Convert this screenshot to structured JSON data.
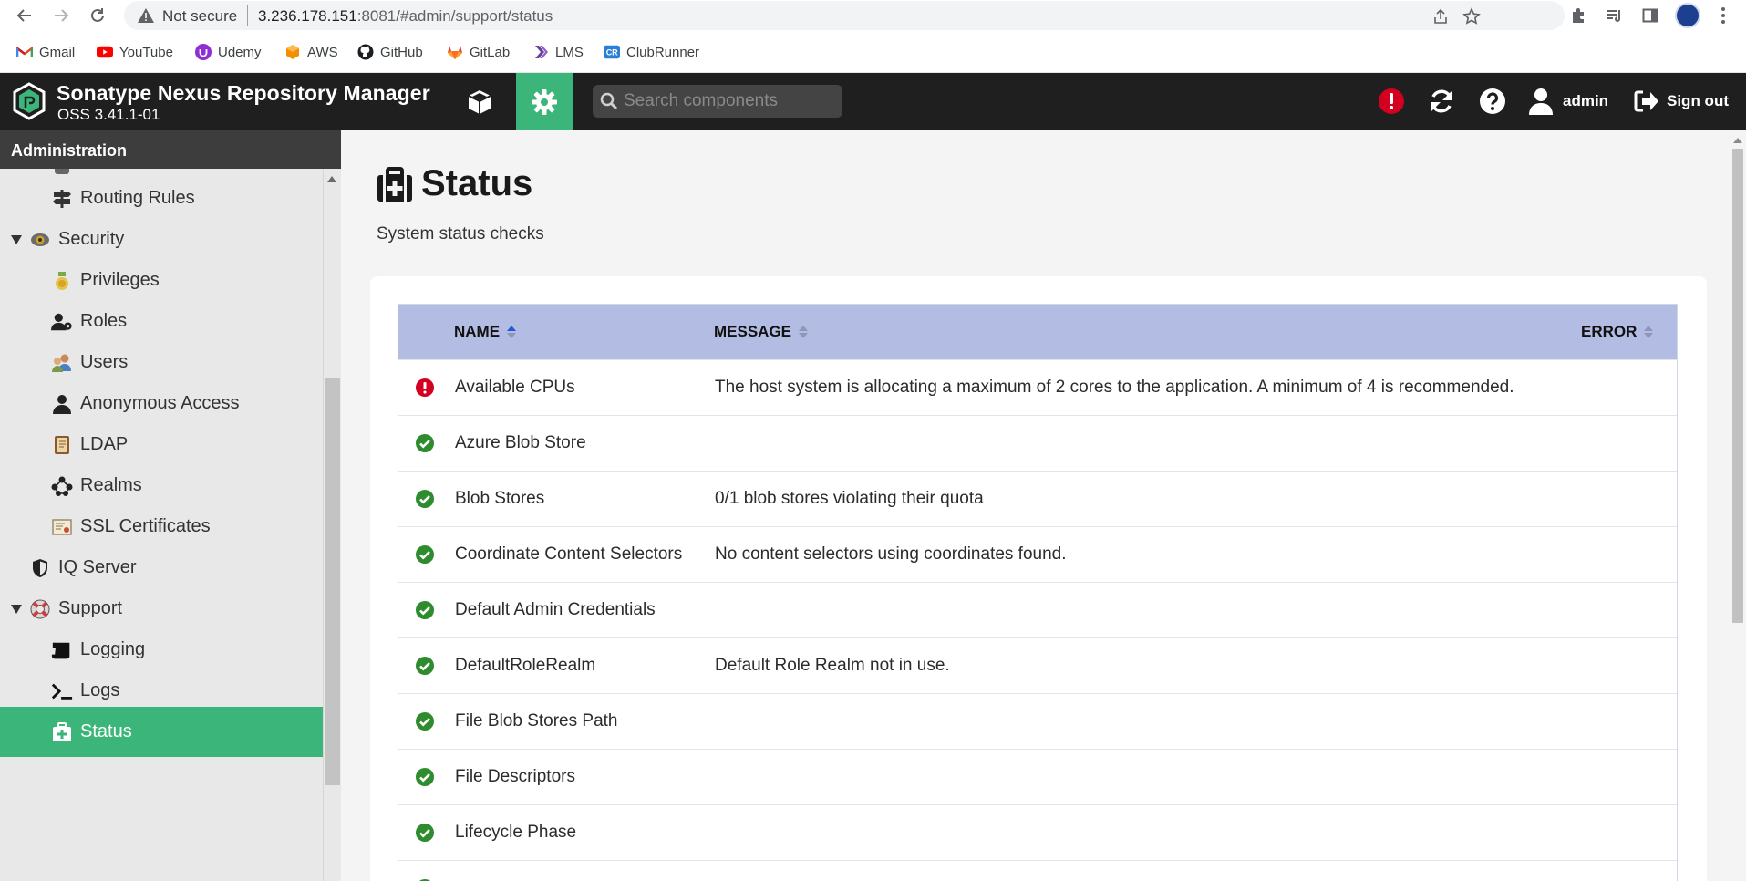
{
  "browser": {
    "security_label": "Not secure",
    "url_host": "3.236.178.151",
    "url_rest": ":8081/#admin/support/status",
    "bookmarks": [
      {
        "label": "Gmail",
        "icon": "gmail-icon"
      },
      {
        "label": "YouTube",
        "icon": "youtube-icon"
      },
      {
        "label": "Udemy",
        "icon": "udemy-icon"
      },
      {
        "label": "AWS",
        "icon": "aws-icon"
      },
      {
        "label": "GitHub",
        "icon": "github-icon"
      },
      {
        "label": "GitLab",
        "icon": "gitlab-icon"
      },
      {
        "label": "LMS",
        "icon": "lms-icon"
      },
      {
        "label": "ClubRunner",
        "icon": "clubrunner-icon"
      }
    ]
  },
  "header": {
    "title": "Sonatype Nexus Repository Manager",
    "version": "OSS 3.41.1-01",
    "search_placeholder": "Search components",
    "user": "admin",
    "signout": "Sign out"
  },
  "sidebar": {
    "heading": "Administration",
    "items": [
      {
        "label": "Routing Rules",
        "icon": "signpost-icon",
        "level": 2
      },
      {
        "label": "Security",
        "icon": "security-badge-icon",
        "level": 1,
        "expanded": true
      },
      {
        "label": "Privileges",
        "icon": "medal-icon",
        "level": 2
      },
      {
        "label": "Roles",
        "icon": "user-gear-icon",
        "level": 2
      },
      {
        "label": "Users",
        "icon": "users-icon",
        "level": 2
      },
      {
        "label": "Anonymous Access",
        "icon": "user-icon",
        "level": 2
      },
      {
        "label": "LDAP",
        "icon": "book-icon",
        "level": 2
      },
      {
        "label": "Realms",
        "icon": "network-icon",
        "level": 2
      },
      {
        "label": "SSL Certificates",
        "icon": "certificate-icon",
        "level": 2
      },
      {
        "label": "IQ Server",
        "icon": "shield-icon",
        "level": 1
      },
      {
        "label": "Support",
        "icon": "lifebuoy-icon",
        "level": 1,
        "expanded": true
      },
      {
        "label": "Logging",
        "icon": "scroll-icon",
        "level": 2
      },
      {
        "label": "Logs",
        "icon": "terminal-icon",
        "level": 2
      },
      {
        "label": "Status",
        "icon": "medkit-icon",
        "level": 2,
        "active": true
      }
    ]
  },
  "page": {
    "title": "Status",
    "subtitle": "System status checks"
  },
  "table": {
    "columns": [
      "NAME",
      "MESSAGE",
      "ERROR"
    ],
    "sorted_column": "NAME",
    "rows": [
      {
        "status": "error",
        "name": "Available CPUs",
        "message": "The host system is allocating a maximum of 2 cores to the application. A minimum of 4 is recommended."
      },
      {
        "status": "ok",
        "name": "Azure Blob Store",
        "message": ""
      },
      {
        "status": "ok",
        "name": "Blob Stores",
        "message": "0/1 blob stores violating their quota"
      },
      {
        "status": "ok",
        "name": "Coordinate Content Selectors",
        "message": "No content selectors using coordinates found."
      },
      {
        "status": "ok",
        "name": "Default Admin Credentials",
        "message": ""
      },
      {
        "status": "ok",
        "name": "DefaultRoleRealm",
        "message": "Default Role Realm not in use."
      },
      {
        "status": "ok",
        "name": "File Blob Stores Path",
        "message": ""
      },
      {
        "status": "ok",
        "name": "File Descriptors",
        "message": ""
      },
      {
        "status": "ok",
        "name": "Lifecycle Phase",
        "message": ""
      }
    ]
  },
  "colors": {
    "accent_green": "#3bb57a",
    "header_bg": "#1f1f1f",
    "table_header_bg": "#b3bce3",
    "error_red": "#d4001f",
    "ok_green": "#2e8b2e"
  }
}
